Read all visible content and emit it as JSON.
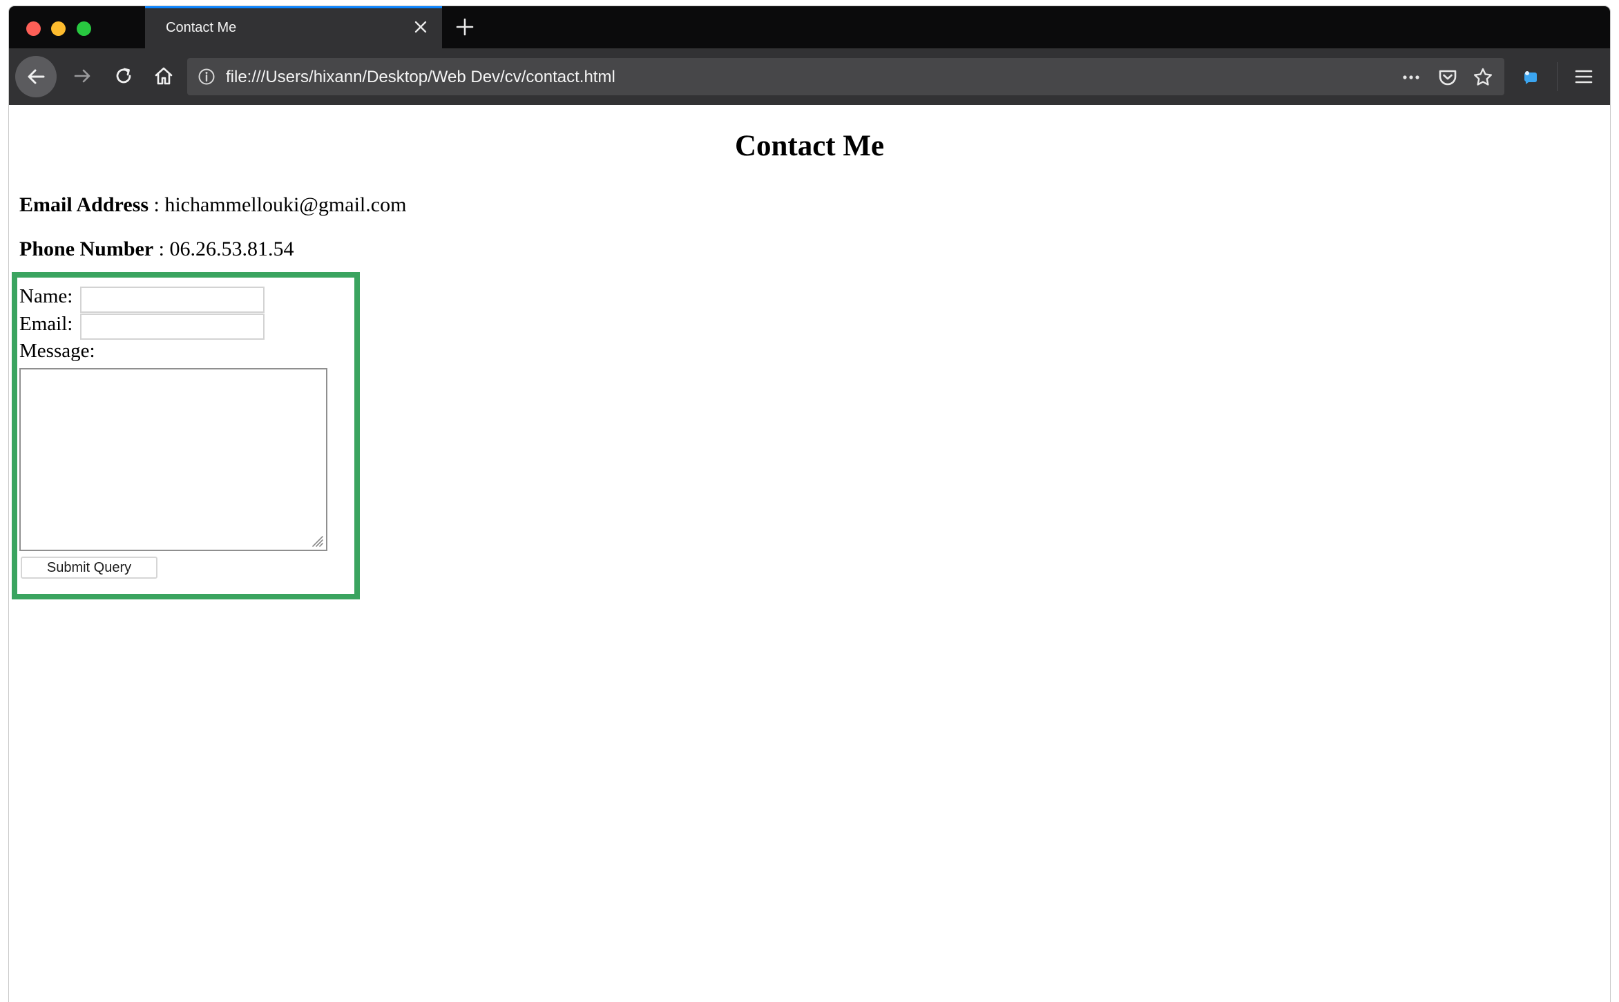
{
  "browser": {
    "tab": {
      "title": "Contact Me"
    },
    "url": "file:///Users/hixann/Desktop/Web Dev/cv/contact.html",
    "icons": {
      "traffic_close": "red-dot",
      "traffic_minimize": "yellow-dot",
      "traffic_zoom": "green-dot",
      "tab_close": "close-icon",
      "new_tab": "plus-icon",
      "back": "back-arrow-icon",
      "forward": "forward-arrow-icon",
      "reload": "reload-icon",
      "home": "home-icon",
      "info": "info-icon",
      "more": "more-dots-icon",
      "pocket": "pocket-icon",
      "bookmark": "star-icon",
      "extension": "extension-icon",
      "menu": "hamburger-menu-icon"
    },
    "colors": {
      "tab_accent": "#0a84ff",
      "traffic_red": "#fe5f57",
      "traffic_yellow": "#febc2e",
      "traffic_green": "#28c840"
    }
  },
  "page": {
    "title": "Contact Me",
    "email": {
      "label": "Email Address",
      "separator": " : ",
      "value": "hichammellouki@gmail.com"
    },
    "phone": {
      "label": "Phone Number",
      "separator": " : ",
      "value": "06.26.53.81.54"
    },
    "form": {
      "name_label": "Name:",
      "name_value": "",
      "email_label": "Email:",
      "email_value": "",
      "message_label": "Message:",
      "message_value": "",
      "submit_label": "Submit Query"
    },
    "highlight_color": "#3aa45f"
  }
}
